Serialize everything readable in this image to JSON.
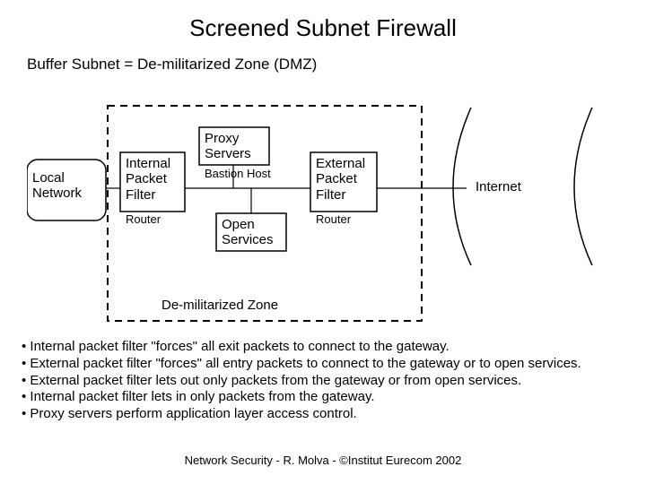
{
  "title": "Screened Subnet Firewall",
  "subtitle": "Buffer Subnet = De-militarized Zone (DMZ)",
  "diagram": {
    "local_network": "Local\nNetwork",
    "internal_pf": "Internal\nPacket\nFilter",
    "internal_pf_sub": "Router",
    "proxy_servers": "Proxy\nServers",
    "bastion_host": "Bastion Host",
    "open_services": "Open\nServices",
    "external_pf": "External\nPacket\nFilter",
    "external_pf_sub": "Router",
    "internet": "Internet",
    "dmz_caption": "De-militarized Zone"
  },
  "bullets_html": "• Internal packet filter \"forces\" all exit packets to connect to the gateway.<br>• External packet filter \"forces\" all entry packets to connect to the gateway or to open services.<br>• External packet filter lets out only packets from the gateway or from open services.<br>• Internal packet filter lets in only packets from the gateway.<br>• Proxy servers perform application layer access control.",
  "footer": "Network Security - R. Molva - ©Institut Eurecom 2002"
}
